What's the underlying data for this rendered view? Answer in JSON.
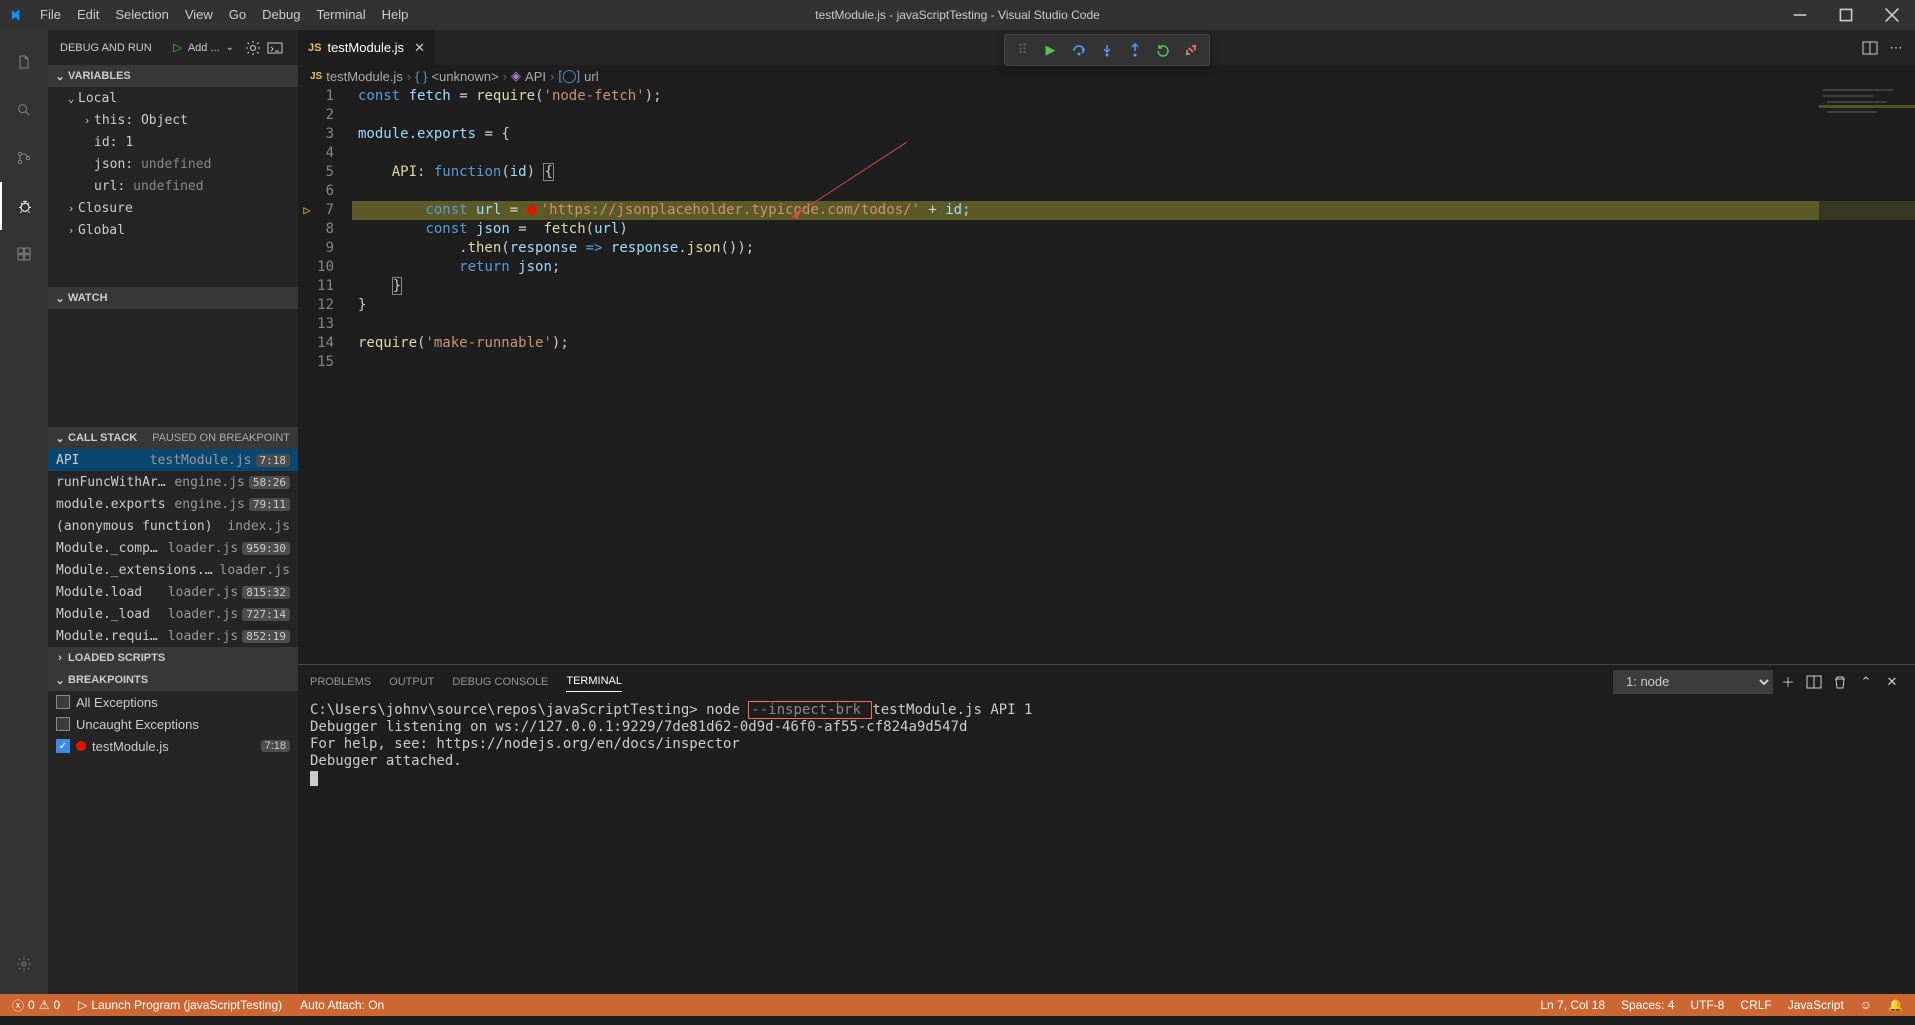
{
  "title": "testModule.js - javaScriptTesting - Visual Studio Code",
  "menu": [
    "File",
    "Edit",
    "Selection",
    "View",
    "Go",
    "Debug",
    "Terminal",
    "Help"
  ],
  "sidebar": {
    "title": "DEBUG AND RUN",
    "config": "Add ...",
    "sections": {
      "variables": "VARIABLES",
      "watch": "WATCH",
      "callstack": "CALL STACK",
      "callstack_status": "Paused on breakpoint",
      "loaded": "LOADED SCRIPTS",
      "breakpoints": "BREAKPOINTS"
    },
    "vars": {
      "local": "Local",
      "this": {
        "k": "this",
        "v": "Object"
      },
      "id": {
        "k": "id",
        "v": "1"
      },
      "json": {
        "k": "json",
        "v": "undefined"
      },
      "url": {
        "k": "url",
        "v": "undefined"
      },
      "closure": "Closure",
      "global": "Global"
    },
    "stack": [
      {
        "name": "API",
        "file": "testModule.js",
        "pos": "7:18",
        "active": true
      },
      {
        "name": "runFuncWithArgs",
        "file": "engine.js",
        "pos": "58:26"
      },
      {
        "name": "module.exports",
        "file": "engine.js",
        "pos": "79:11"
      },
      {
        "name": "(anonymous function)",
        "file": "index.js",
        "pos": ""
      },
      {
        "name": "Module._compile",
        "file": "loader.js",
        "pos": "959:30"
      },
      {
        "name": "Module._extensions..js",
        "file": "loader.js",
        "pos": ""
      },
      {
        "name": "Module.load",
        "file": "loader.js",
        "pos": "815:32"
      },
      {
        "name": "Module._load",
        "file": "loader.js",
        "pos": "727:14"
      },
      {
        "name": "Module.require",
        "file": "loader.js",
        "pos": "852:19"
      }
    ],
    "breakpoints": {
      "all": "All Exceptions",
      "uncaught": "Uncaught Exceptions",
      "file": "testModule.js",
      "file_pos": "7:18"
    }
  },
  "tab": {
    "name": "testModule.js"
  },
  "breadcrumbs": {
    "file": "testModule.js",
    "unknown": "<unknown>",
    "api": "API",
    "url": "url"
  },
  "code": {
    "l1": "const fetch = require('node-fetch');",
    "l3": "module.exports = {",
    "l5": "    API: function(id) {",
    "l7a": "        const url = ",
    "l7b": "'https://jsonplaceholder.typicode.com/todos/'",
    "l7c": " + id;",
    "l8": "        const json =  fetch(url)",
    "l9": "            .then(response => response.json());",
    "l10": "            return json;",
    "l11": "    }",
    "l12": "}",
    "l14": "require('make-runnable');"
  },
  "panel": {
    "tabs": {
      "problems": "PROBLEMS",
      "output": "OUTPUT",
      "debugconsole": "DEBUG CONSOLE",
      "terminal": "TERMINAL"
    },
    "term_select": "1: node",
    "term_prompt": "C:\\Users\\johnv\\source\\repos\\javaScriptTesting> ",
    "term_cmd1": "node ",
    "term_flag": "--inspect-brk ",
    "term_cmd2": "testModule.js API 1",
    "term_l2": "Debugger listening on ws://127.0.0.1:9229/7de81d62-0d9d-46f0-af55-cf824a9d547d",
    "term_l3": "For help, see: https://nodejs.org/en/docs/inspector",
    "term_l4": "Debugger attached."
  },
  "statusbar": {
    "errors": "0",
    "warnings": "0",
    "launch": "Launch Program (javaScriptTesting)",
    "autoattach": "Auto Attach: On",
    "ln": "Ln 7, Col 18",
    "spaces": "Spaces: 4",
    "encoding": "UTF-8",
    "eol": "CRLF",
    "lang": "JavaScript"
  }
}
